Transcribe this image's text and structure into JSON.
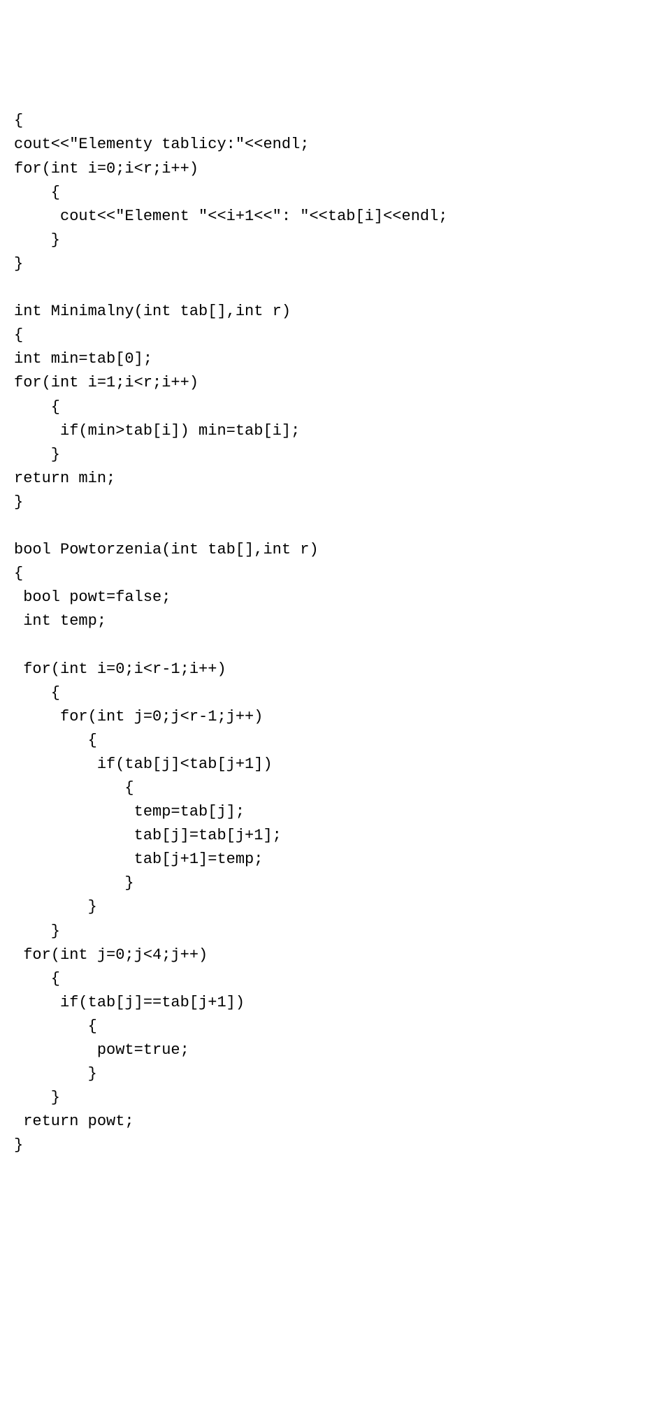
{
  "code_lines": [
    "{",
    "cout<<\"Elementy tablicy:\"<<endl;",
    "for(int i=0;i<r;i++)",
    "    {",
    "     cout<<\"Element \"<<i+1<<\": \"<<tab[i]<<endl;",
    "    }",
    "}",
    "",
    "int Minimalny(int tab[],int r)",
    "{",
    "int min=tab[0];",
    "for(int i=1;i<r;i++)",
    "    {",
    "     if(min>tab[i]) min=tab[i];",
    "    }",
    "return min;",
    "}",
    "",
    "bool Powtorzenia(int tab[],int r)",
    "{",
    " bool powt=false;",
    " int temp;",
    "",
    " for(int i=0;i<r-1;i++)",
    "    {",
    "     for(int j=0;j<r-1;j++)",
    "        {",
    "         if(tab[j]<tab[j+1])",
    "            {",
    "             temp=tab[j];",
    "             tab[j]=tab[j+1];",
    "             tab[j+1]=temp;",
    "            }",
    "        }",
    "    }",
    " for(int j=0;j<4;j++)",
    "    {",
    "     if(tab[j]==tab[j+1])",
    "        {",
    "         powt=true;",
    "        }",
    "    }",
    " return powt;",
    "}"
  ]
}
